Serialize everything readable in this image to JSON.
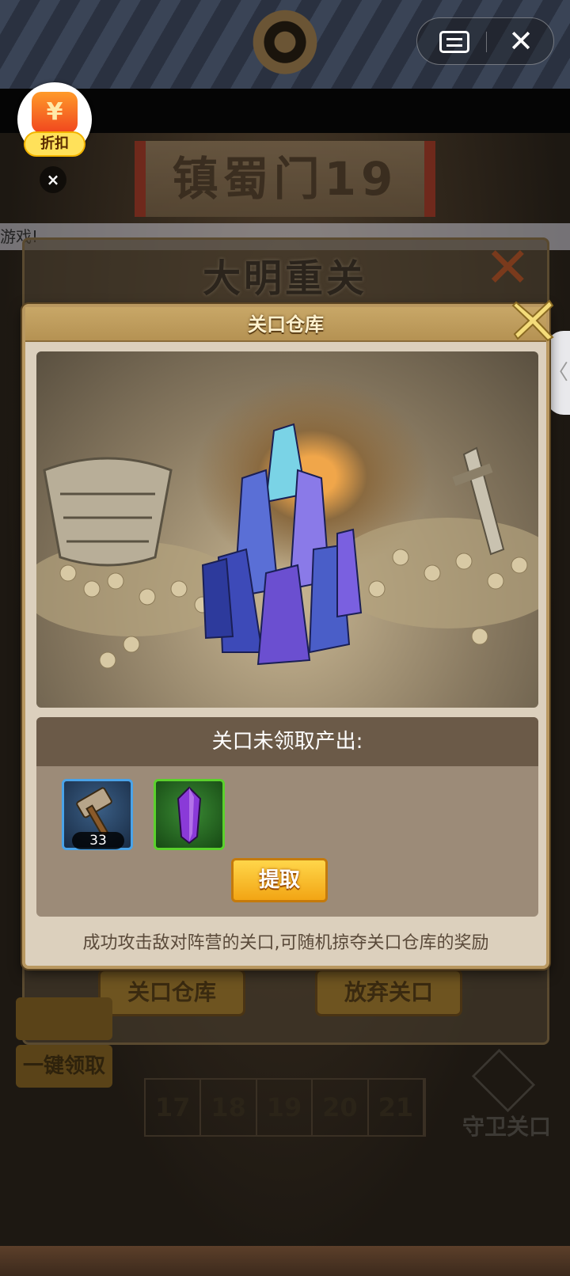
{
  "background": {
    "banner_text": "镇蜀门19",
    "marquee_text": "游戏!",
    "panel_title": "大明重关",
    "left_buttons": [
      "一键领取"
    ],
    "bottom_buttons": [
      "关口仓库",
      "放弃关口"
    ],
    "level_numbers": [
      "17",
      "18",
      "19",
      "20",
      "21"
    ],
    "guard_label": "守卫关口"
  },
  "top_bar": {
    "menu_icon": "ticket-menu-icon",
    "close_icon": "close-icon"
  },
  "discount_badge": {
    "icon": "yuan-coin-icon",
    "coin_glyph": "¥",
    "label": "折扣",
    "close_glyph": "×"
  },
  "side_handle": {
    "glyph": "〈"
  },
  "dialog": {
    "title": "关口仓库",
    "output_header": "关口未领取产出:",
    "items": [
      {
        "icon": "hammer-icon",
        "count": "33",
        "border_color": "#4aa3e8"
      },
      {
        "icon": "purple-crystal-icon",
        "count": "",
        "border_color": "#5bd12c"
      }
    ],
    "claim_label": "提取",
    "hint": "成功攻击敌对阵营的关口,可随机掠夺关口仓库的奖励"
  },
  "colors": {
    "dialog_bg": "#dcd0bd",
    "header_gold": "#c8a767",
    "output_header": "#6b5a48",
    "claim_button": "#f2a514"
  }
}
